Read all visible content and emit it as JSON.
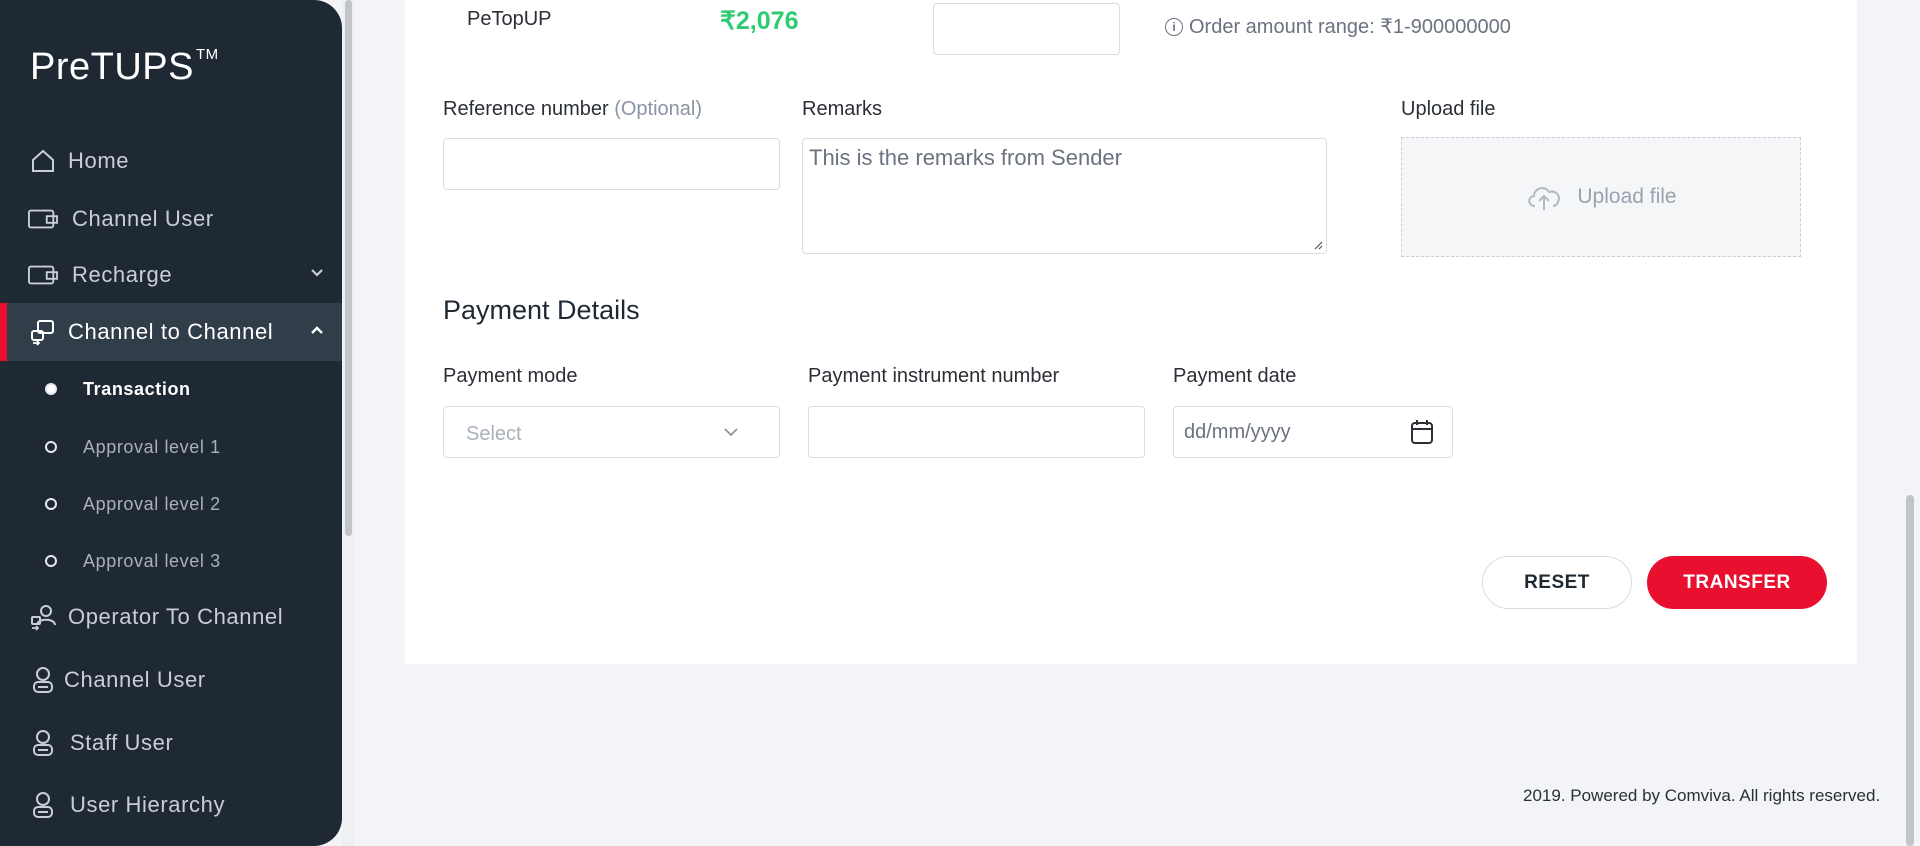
{
  "sidebar": {
    "logo": "PreTUPS",
    "logo_mark": "TM",
    "items": [
      {
        "label": "Home",
        "icon": "home-icon"
      },
      {
        "label": "Channel User",
        "icon": "wallet-icon"
      },
      {
        "label": "Recharge",
        "icon": "wallet-icon"
      },
      {
        "label": "Channel to Channel",
        "icon": "transfer-icon"
      },
      {
        "label": "Operator To Channel",
        "icon": "transfer-user-icon"
      },
      {
        "label": "Channel User",
        "icon": "user-icon"
      },
      {
        "label": "Staff User",
        "icon": "user-icon"
      },
      {
        "label": "User Hierarchy",
        "icon": "user-icon"
      }
    ],
    "sub_items": [
      {
        "label": "Transaction"
      },
      {
        "label": "Approval level 1"
      },
      {
        "label": "Approval level 2"
      },
      {
        "label": "Approval level 3"
      }
    ]
  },
  "form": {
    "wallet_name": "PeTopUP",
    "wallet_balance": "₹2,076",
    "range_text": "Order amount range: ₹1-900000000",
    "reference_label": "Reference number",
    "reference_optional": "(Optional)",
    "remarks_label": "Remarks",
    "remarks_value": "This is the remarks from Sender",
    "upload_label": "Upload file",
    "upload_button": "Upload file"
  },
  "payment": {
    "title": "Payment Details",
    "mode_label": "Payment mode",
    "mode_placeholder": "Select",
    "instrument_label": "Payment instrument number",
    "date_label": "Payment date",
    "date_placeholder": "dd/mm/yyyy"
  },
  "actions": {
    "reset": "RESET",
    "transfer": "TRANSFER"
  },
  "footer": {
    "text": "2019. Powered by Comviva. All rights reserved."
  },
  "colors": {
    "sidebar_bg": "#1f2933",
    "accent": "#e8102e",
    "balance_green": "#2ecc71"
  }
}
